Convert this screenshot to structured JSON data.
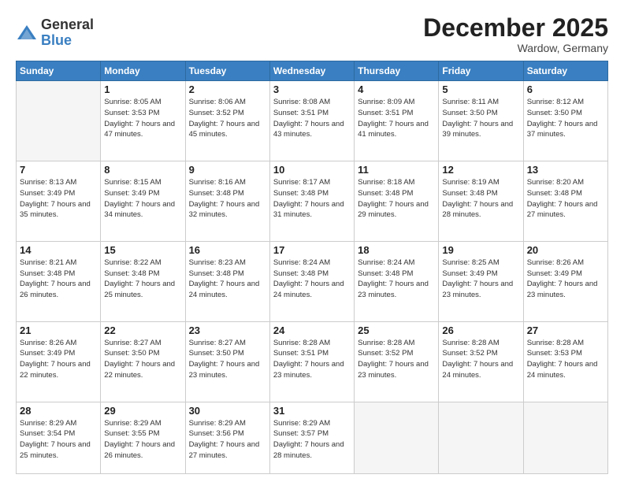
{
  "logo": {
    "general": "General",
    "blue": "Blue"
  },
  "title": "December 2025",
  "location": "Wardow, Germany",
  "days_header": [
    "Sunday",
    "Monday",
    "Tuesday",
    "Wednesday",
    "Thursday",
    "Friday",
    "Saturday"
  ],
  "weeks": [
    [
      {
        "day": "",
        "sunrise": "",
        "sunset": "",
        "daylight": "",
        "empty": true
      },
      {
        "day": "1",
        "sunrise": "Sunrise: 8:05 AM",
        "sunset": "Sunset: 3:53 PM",
        "daylight": "Daylight: 7 hours and 47 minutes."
      },
      {
        "day": "2",
        "sunrise": "Sunrise: 8:06 AM",
        "sunset": "Sunset: 3:52 PM",
        "daylight": "Daylight: 7 hours and 45 minutes."
      },
      {
        "day": "3",
        "sunrise": "Sunrise: 8:08 AM",
        "sunset": "Sunset: 3:51 PM",
        "daylight": "Daylight: 7 hours and 43 minutes."
      },
      {
        "day": "4",
        "sunrise": "Sunrise: 8:09 AM",
        "sunset": "Sunset: 3:51 PM",
        "daylight": "Daylight: 7 hours and 41 minutes."
      },
      {
        "day": "5",
        "sunrise": "Sunrise: 8:11 AM",
        "sunset": "Sunset: 3:50 PM",
        "daylight": "Daylight: 7 hours and 39 minutes."
      },
      {
        "day": "6",
        "sunrise": "Sunrise: 8:12 AM",
        "sunset": "Sunset: 3:50 PM",
        "daylight": "Daylight: 7 hours and 37 minutes."
      }
    ],
    [
      {
        "day": "7",
        "sunrise": "Sunrise: 8:13 AM",
        "sunset": "Sunset: 3:49 PM",
        "daylight": "Daylight: 7 hours and 35 minutes."
      },
      {
        "day": "8",
        "sunrise": "Sunrise: 8:15 AM",
        "sunset": "Sunset: 3:49 PM",
        "daylight": "Daylight: 7 hours and 34 minutes."
      },
      {
        "day": "9",
        "sunrise": "Sunrise: 8:16 AM",
        "sunset": "Sunset: 3:48 PM",
        "daylight": "Daylight: 7 hours and 32 minutes."
      },
      {
        "day": "10",
        "sunrise": "Sunrise: 8:17 AM",
        "sunset": "Sunset: 3:48 PM",
        "daylight": "Daylight: 7 hours and 31 minutes."
      },
      {
        "day": "11",
        "sunrise": "Sunrise: 8:18 AM",
        "sunset": "Sunset: 3:48 PM",
        "daylight": "Daylight: 7 hours and 29 minutes."
      },
      {
        "day": "12",
        "sunrise": "Sunrise: 8:19 AM",
        "sunset": "Sunset: 3:48 PM",
        "daylight": "Daylight: 7 hours and 28 minutes."
      },
      {
        "day": "13",
        "sunrise": "Sunrise: 8:20 AM",
        "sunset": "Sunset: 3:48 PM",
        "daylight": "Daylight: 7 hours and 27 minutes."
      }
    ],
    [
      {
        "day": "14",
        "sunrise": "Sunrise: 8:21 AM",
        "sunset": "Sunset: 3:48 PM",
        "daylight": "Daylight: 7 hours and 26 minutes."
      },
      {
        "day": "15",
        "sunrise": "Sunrise: 8:22 AM",
        "sunset": "Sunset: 3:48 PM",
        "daylight": "Daylight: 7 hours and 25 minutes."
      },
      {
        "day": "16",
        "sunrise": "Sunrise: 8:23 AM",
        "sunset": "Sunset: 3:48 PM",
        "daylight": "Daylight: 7 hours and 24 minutes."
      },
      {
        "day": "17",
        "sunrise": "Sunrise: 8:24 AM",
        "sunset": "Sunset: 3:48 PM",
        "daylight": "Daylight: 7 hours and 24 minutes."
      },
      {
        "day": "18",
        "sunrise": "Sunrise: 8:24 AM",
        "sunset": "Sunset: 3:48 PM",
        "daylight": "Daylight: 7 hours and 23 minutes."
      },
      {
        "day": "19",
        "sunrise": "Sunrise: 8:25 AM",
        "sunset": "Sunset: 3:49 PM",
        "daylight": "Daylight: 7 hours and 23 minutes."
      },
      {
        "day": "20",
        "sunrise": "Sunrise: 8:26 AM",
        "sunset": "Sunset: 3:49 PM",
        "daylight": "Daylight: 7 hours and 23 minutes."
      }
    ],
    [
      {
        "day": "21",
        "sunrise": "Sunrise: 8:26 AM",
        "sunset": "Sunset: 3:49 PM",
        "daylight": "Daylight: 7 hours and 22 minutes."
      },
      {
        "day": "22",
        "sunrise": "Sunrise: 8:27 AM",
        "sunset": "Sunset: 3:50 PM",
        "daylight": "Daylight: 7 hours and 22 minutes."
      },
      {
        "day": "23",
        "sunrise": "Sunrise: 8:27 AM",
        "sunset": "Sunset: 3:50 PM",
        "daylight": "Daylight: 7 hours and 23 minutes."
      },
      {
        "day": "24",
        "sunrise": "Sunrise: 8:28 AM",
        "sunset": "Sunset: 3:51 PM",
        "daylight": "Daylight: 7 hours and 23 minutes."
      },
      {
        "day": "25",
        "sunrise": "Sunrise: 8:28 AM",
        "sunset": "Sunset: 3:52 PM",
        "daylight": "Daylight: 7 hours and 23 minutes."
      },
      {
        "day": "26",
        "sunrise": "Sunrise: 8:28 AM",
        "sunset": "Sunset: 3:52 PM",
        "daylight": "Daylight: 7 hours and 24 minutes."
      },
      {
        "day": "27",
        "sunrise": "Sunrise: 8:28 AM",
        "sunset": "Sunset: 3:53 PM",
        "daylight": "Daylight: 7 hours and 24 minutes."
      }
    ],
    [
      {
        "day": "28",
        "sunrise": "Sunrise: 8:29 AM",
        "sunset": "Sunset: 3:54 PM",
        "daylight": "Daylight: 7 hours and 25 minutes."
      },
      {
        "day": "29",
        "sunrise": "Sunrise: 8:29 AM",
        "sunset": "Sunset: 3:55 PM",
        "daylight": "Daylight: 7 hours and 26 minutes."
      },
      {
        "day": "30",
        "sunrise": "Sunrise: 8:29 AM",
        "sunset": "Sunset: 3:56 PM",
        "daylight": "Daylight: 7 hours and 27 minutes."
      },
      {
        "day": "31",
        "sunrise": "Sunrise: 8:29 AM",
        "sunset": "Sunset: 3:57 PM",
        "daylight": "Daylight: 7 hours and 28 minutes."
      },
      {
        "day": "",
        "empty": true
      },
      {
        "day": "",
        "empty": true
      },
      {
        "day": "",
        "empty": true
      }
    ]
  ]
}
